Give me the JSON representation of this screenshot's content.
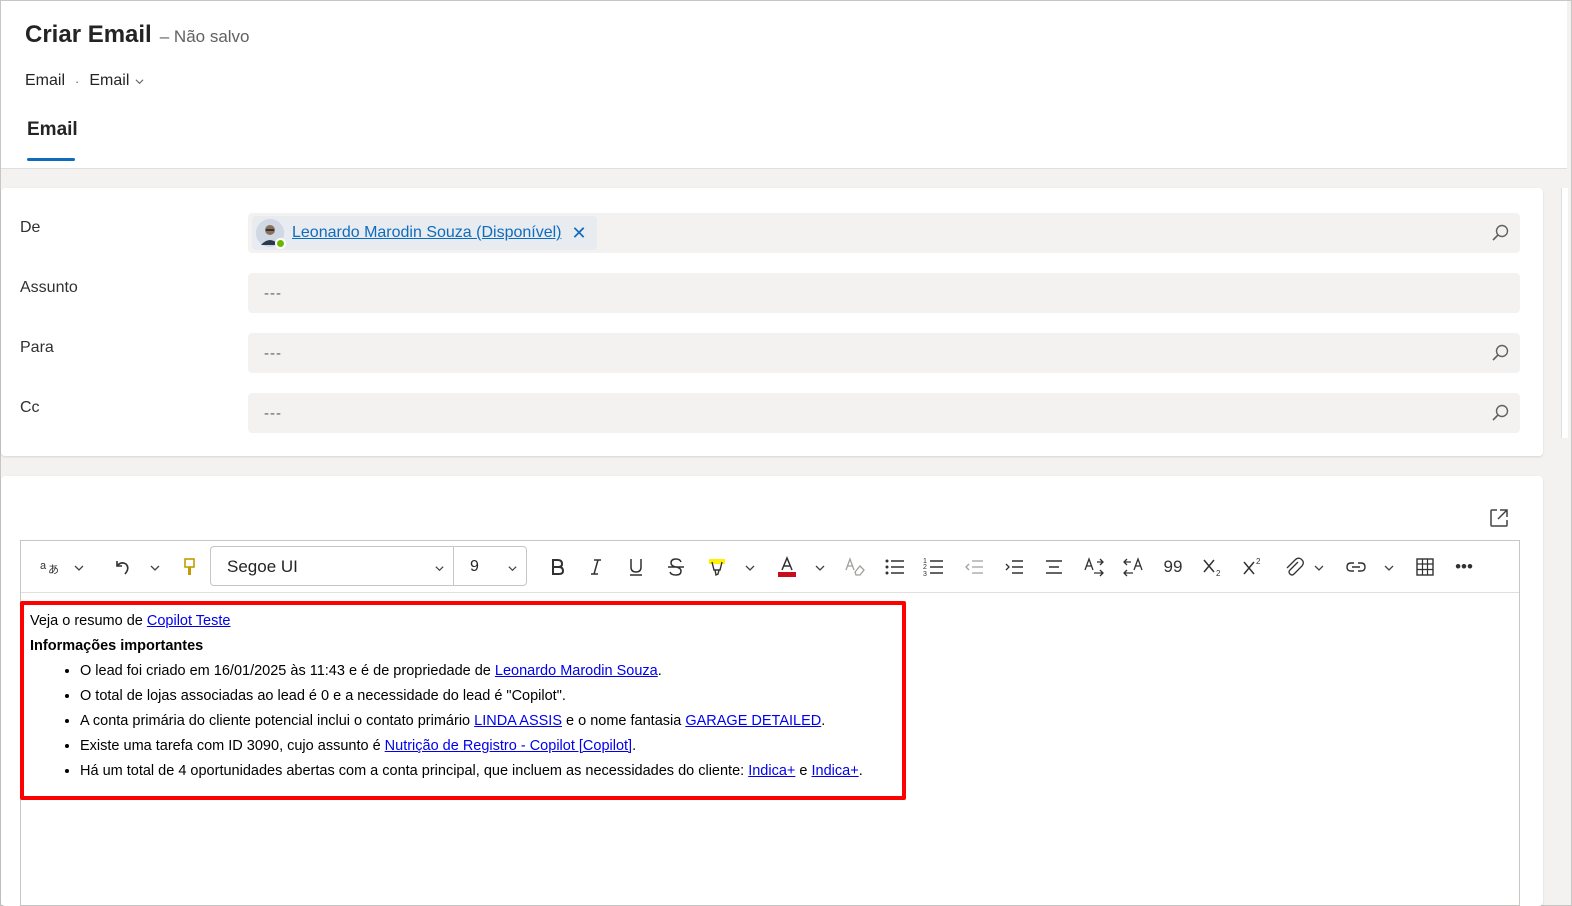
{
  "header": {
    "title": "Criar Email",
    "status": "– Não salvo",
    "breadcrumb": [
      "Email",
      "·",
      "Email"
    ],
    "tab": "Email"
  },
  "fields": {
    "from_label": "De",
    "from_value": "Leonardo Marodin Souza (Disponível)",
    "subject_label": "Assunto",
    "subject_value": "---",
    "to_label": "Para",
    "to_value": "---",
    "cc_label": "Cc",
    "cc_value": "---"
  },
  "toolbar": {
    "font": "Segoe UI",
    "size": "9",
    "quote_glyph": "99",
    "more_glyph": "•••"
  },
  "body": {
    "intro_prefix": "Veja o resumo de ",
    "intro_link": "Copilot Teste",
    "heading": "Informações importantes",
    "b1_text": "O lead foi criado em 16/01/2025 às 11:43 e é de propriedade de ",
    "b1_link": "Leonardo Marodin Souza",
    "b1_end": ".",
    "b2_text": "O total de lojas associadas ao lead é 0 e a necessidade do lead é \"Copilot\".",
    "b3_text": "A conta primária do cliente potencial inclui o contato primário ",
    "b3_link1": "LINDA ASSIS",
    "b3_mid": " e o nome fantasia ",
    "b3_link2": "GARAGE DETAILED",
    "b3_end": ".",
    "b4_text": "Existe uma tarefa com ID 3090, cujo assunto é ",
    "b4_link": "Nutrição de Registro - Copilot [Copilot]",
    "b4_end": ".",
    "b5_text": "Há um total de 4 oportunidades abertas com a conta principal, que incluem as necessidades do cliente: ",
    "b5_link1": "Indica+",
    "b5_mid": " e ",
    "b5_link2": "Indica+",
    "b5_end": "."
  },
  "colors": {
    "accent": "#0f6cbd",
    "highlight_border": "#ff0000",
    "presence": "#6bb700"
  }
}
